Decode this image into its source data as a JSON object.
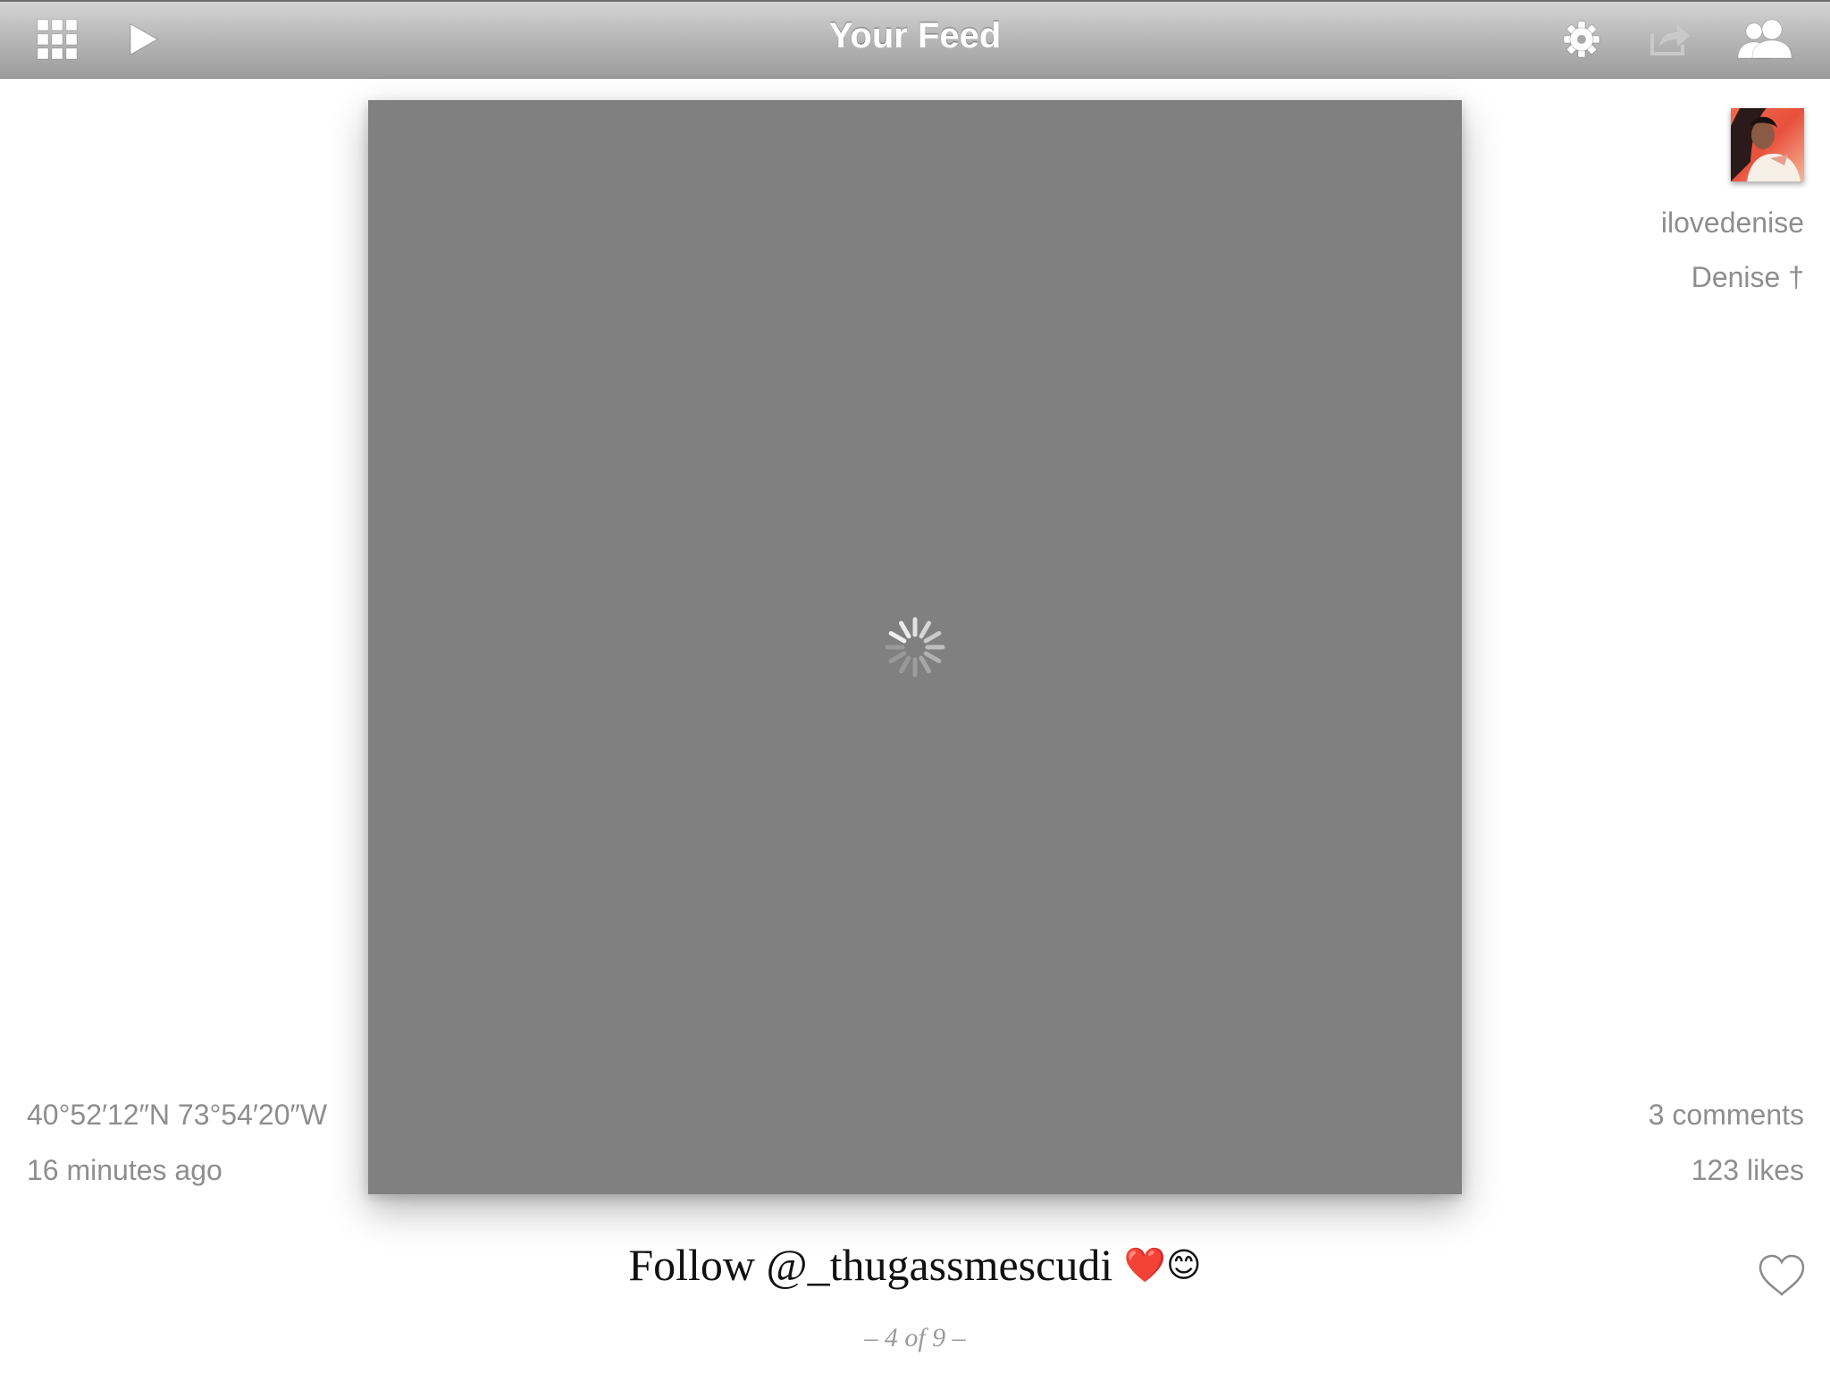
{
  "navbar": {
    "title": "Your Feed",
    "icons": {
      "grid": "grid-icon",
      "play": "play-icon",
      "settings": "gear-icon",
      "share": "share-icon",
      "people": "people-icon"
    }
  },
  "post": {
    "username": "ilovedenise",
    "full_name": "Denise †",
    "location": "40°52′12″N 73°54′20″W",
    "time_ago": "16 minutes ago",
    "comments": "3 comments",
    "likes": "123 likes",
    "caption_text": "Follow @_thugassmescudi",
    "caption_emoji": "❤️😊",
    "photo_state": "loading"
  },
  "pager": {
    "text": "– 4 of 9 –",
    "current": 4,
    "total": 9
  },
  "colors": {
    "nav_top": "#d4d4d4",
    "nav_bottom": "#9c9c9c",
    "photo_placeholder": "#808080",
    "meta_text": "#8e8e8e"
  }
}
